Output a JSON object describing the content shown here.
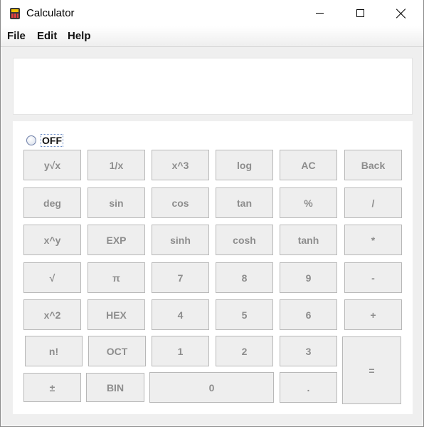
{
  "window": {
    "title": "Calculator",
    "controls": {
      "minimize": "minimize",
      "maximize": "maximize",
      "close": "close"
    }
  },
  "menu": {
    "file": "File",
    "edit": "Edit",
    "help": "Help"
  },
  "display": {
    "value": ""
  },
  "power": {
    "label": "OFF",
    "selected": false
  },
  "keys": {
    "y_root_x": "y√x",
    "reciprocal": "1/x",
    "x_cubed": "x^3",
    "log": "log",
    "ac": "AC",
    "back": "Back",
    "deg": "deg",
    "sin": "sin",
    "cos": "cos",
    "tan": "tan",
    "percent": "%",
    "divide": "/",
    "x_pow_y": "x^y",
    "exp": "EXP",
    "sinh": "sinh",
    "cosh": "cosh",
    "tanh": "tanh",
    "multiply": "*",
    "sqrt": "√",
    "pi": "π",
    "seven": "7",
    "eight": "8",
    "nine": "9",
    "minus": "-",
    "x_squared": "x^2",
    "hex": "HEX",
    "four": "4",
    "five": "5",
    "six": "6",
    "plus": "+",
    "factorial": "n!",
    "oct": "OCT",
    "one": "1",
    "two": "2",
    "three": "3",
    "equals": "=",
    "plus_minus": "±",
    "bin": "BIN",
    "zero": "0",
    "decimal": "."
  },
  "colors": {
    "key_face": "#eeeeee",
    "key_border": "#b8b8b8",
    "key_text": "#8d8d8d",
    "panel": "#efefef",
    "display": "#ffffff"
  }
}
